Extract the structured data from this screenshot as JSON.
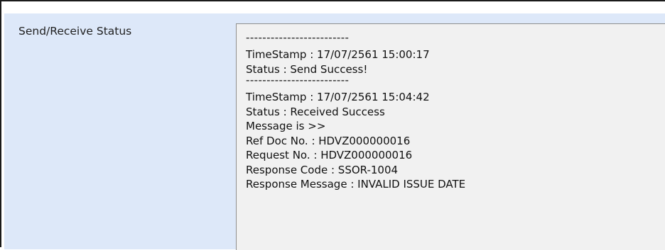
{
  "form": {
    "label": "Send/Receive Status"
  },
  "log": {
    "separator_1": "-------------------------",
    "timestamp_1": "TimeStamp : 17/07/2561 15:00:17",
    "status_1": "Status : Send Success!",
    "separator_2": "-------------------------",
    "timestamp_2": "TimeStamp : 17/07/2561 15:04:42",
    "status_2": "Status : Received Success",
    "message_header": "Message is >>",
    "ref_doc_no": "Ref Doc No. : HDVZ000000016",
    "request_no": "Request No. : HDVZ000000016",
    "response_code": "Response Code : SSOR-1004",
    "response_message": "Response Message : INVALID ISSUE DATE"
  },
  "colors": {
    "panel_background": "#dde8f9",
    "textbox_background": "#f1f1f1"
  }
}
